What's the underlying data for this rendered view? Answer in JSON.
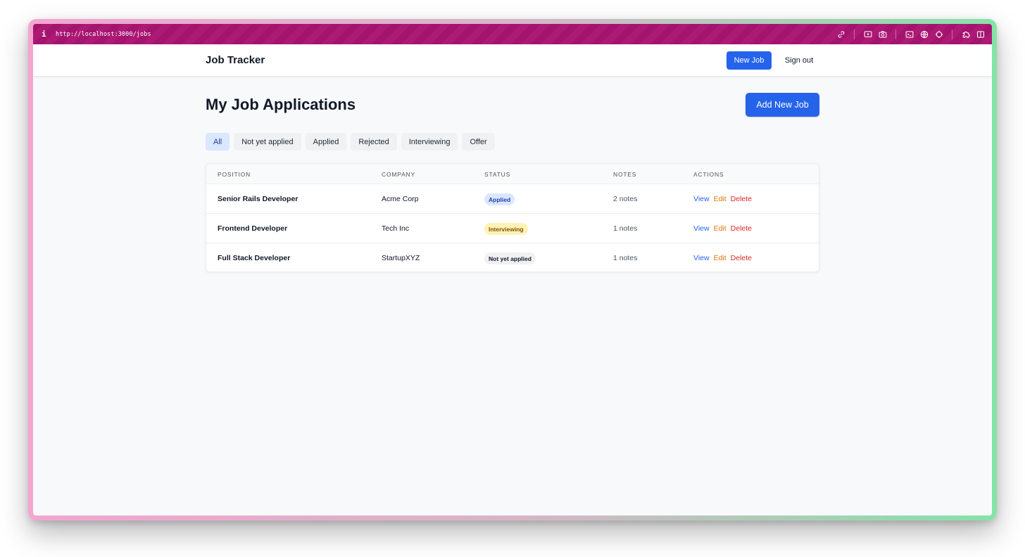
{
  "browser": {
    "info_icon": "i",
    "url": "http://localhost:3000/jobs",
    "icons": [
      "link-icon",
      "screen-record-icon",
      "camera-icon",
      "terminal-icon",
      "globe-icon",
      "crosshair-icon",
      "puzzle-icon",
      "sidebar-icon"
    ]
  },
  "header": {
    "brand": "Job Tracker",
    "new_job_label": "New Job",
    "sign_out_label": "Sign out"
  },
  "main": {
    "title": "My Job Applications",
    "add_button_label": "Add New Job",
    "filters": [
      "All",
      "Not yet applied",
      "Applied",
      "Rejected",
      "Interviewing",
      "Offer"
    ],
    "active_filter": "All"
  },
  "table": {
    "columns": [
      "POSITION",
      "COMPANY",
      "STATUS",
      "NOTES",
      "ACTIONS"
    ],
    "rows": [
      {
        "position": "Senior Rails Developer",
        "company": "Acme Corp",
        "status": "Applied",
        "notes": "2 notes",
        "view": "View",
        "edit": "Edit",
        "delete": "Delete"
      },
      {
        "position": "Frontend Developer",
        "company": "Tech Inc",
        "status": "Interviewing",
        "notes": "1 notes",
        "view": "View",
        "edit": "Edit",
        "delete": "Delete"
      },
      {
        "position": "Full Stack Developer",
        "company": "StartupXYZ",
        "status": "Not yet applied",
        "notes": "1 notes",
        "view": "View",
        "edit": "Edit",
        "delete": "Delete"
      }
    ]
  },
  "colors": {
    "accent": "#2563eb",
    "browser_bar": "#a3146e",
    "status_applied_bg": "#dbe7fd",
    "status_applied_fg": "#1e40af",
    "status_interviewing_bg": "#fdf3b4",
    "status_interviewing_fg": "#854d0e",
    "status_not_applied_bg": "#f0f1f3",
    "status_not_applied_fg": "#111827"
  }
}
